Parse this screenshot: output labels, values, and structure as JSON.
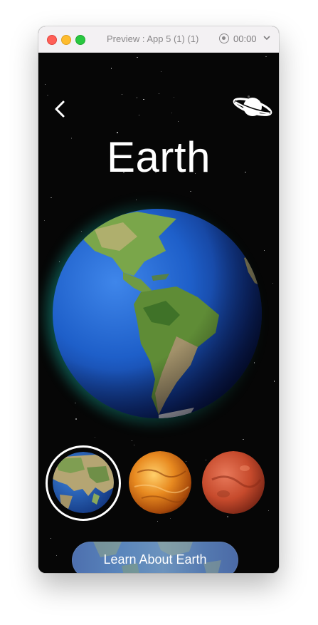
{
  "window": {
    "title": "Preview : App 5 (1) (1)",
    "timer": "00:00"
  },
  "screen": {
    "heading": "Earth",
    "cta_label": "Learn About Earth",
    "thumbnails": [
      {
        "name": "Earth",
        "selected": true
      },
      {
        "name": "Venus",
        "selected": false
      },
      {
        "name": "Mars",
        "selected": false
      }
    ]
  },
  "colors": {
    "background": "#060606",
    "ring": "#ffffff",
    "ocean": "#1e5fc9",
    "glow": "#16c0a8",
    "venus": "#e88a20",
    "mars": "#c64a2c",
    "button": "#5a86bc"
  },
  "icons": [
    "back-chevron-icon",
    "planet-icon",
    "record-icon",
    "chevron-down-icon"
  ]
}
